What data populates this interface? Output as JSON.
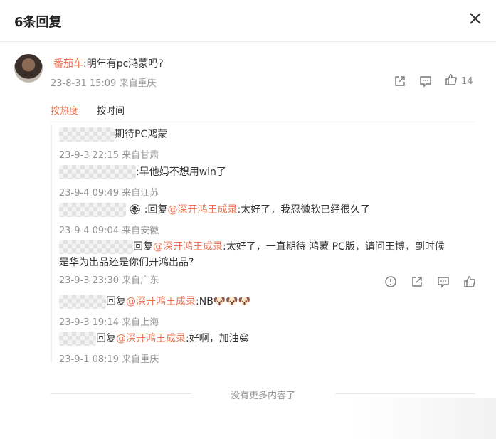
{
  "header": {
    "title": "6条回复"
  },
  "main_comment": {
    "author": "番茄车",
    "text": ":明年有pc鸿蒙吗?",
    "time": "23-8-31 15:09",
    "location": "来自重庆",
    "like_count": "14"
  },
  "tabs": [
    {
      "label": "按热度",
      "active": true
    },
    {
      "label": "按时间",
      "active": false
    }
  ],
  "replies": [
    {
      "prefix": "",
      "mention": "",
      "text": "期待PC鸿蒙",
      "time": "23-9-3 22:15",
      "location": "来自甘肃"
    },
    {
      "prefix": "",
      "mention": "",
      "text": ":早他妈不想用win了",
      "time": "23-9-4 09:49",
      "location": "来自江苏"
    },
    {
      "prefix": ":回复",
      "mention": "@深开鸿王成录",
      "text": ":太好了，我忍微软已经很久了",
      "time": "23-9-4 09:04",
      "location": "来自安徽"
    },
    {
      "prefix": "回复",
      "mention": "@深开鸿王成录",
      "text": ":太好了，一直期待 鸿蒙 PC版，请问王博，到时候",
      "text2": "是华为出品还是你们开鸿出品?",
      "time": "23-9-3 23:30",
      "location": "来自广东"
    },
    {
      "prefix": "回复",
      "mention": "@深开鸿王成录",
      "text": ":NB",
      "time": "23-9-3 19:14",
      "location": "来自上海"
    },
    {
      "prefix": "回复",
      "mention": "@深开鸿王成录",
      "text": ":好啊，加油",
      "time": "23-9-1 08:19",
      "location": "来自重庆"
    }
  ],
  "footer": {
    "text": "没有更多内容了"
  },
  "icons": {
    "close": "close-icon",
    "share": "share-icon",
    "comment": "comment-icon",
    "like": "like-icon",
    "report": "report-icon"
  },
  "colors": {
    "accent": "#eb7350",
    "meta": "#939393"
  }
}
